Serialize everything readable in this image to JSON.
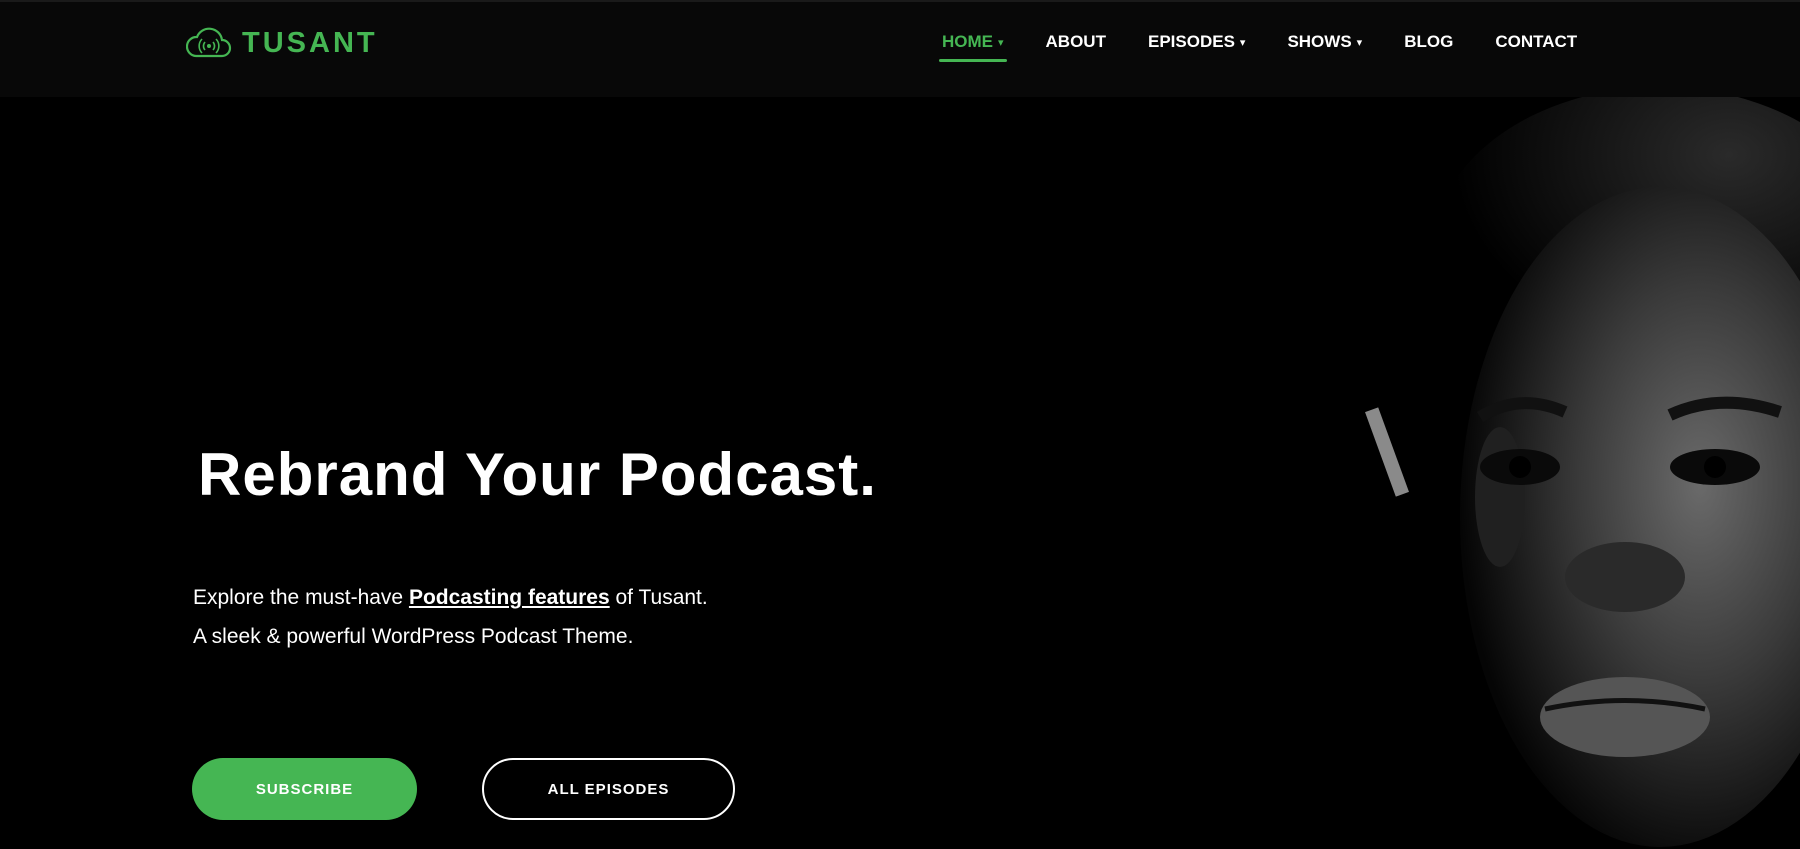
{
  "brand": {
    "name": "TUSANT",
    "accent": "#45b653"
  },
  "nav": {
    "items": [
      {
        "label": "HOME",
        "dropdown": true,
        "active": true
      },
      {
        "label": "ABOUT",
        "dropdown": false
      },
      {
        "label": "EPISODES",
        "dropdown": true
      },
      {
        "label": "SHOWS",
        "dropdown": true
      },
      {
        "label": "BLOG",
        "dropdown": false
      },
      {
        "label": "CONTACT",
        "dropdown": false
      }
    ],
    "chevron": "⌄"
  },
  "hero": {
    "title": "Rebrand Your Podcast.",
    "line1_before": "Explore the must-have ",
    "line1_link": "Podcasting features",
    "line1_after": " of Tusant.",
    "line2": "A sleek & powerful WordPress Podcast Theme.",
    "subscribe_label": "SUBSCRIBE",
    "all_episodes_label": "ALL EPISODES"
  }
}
